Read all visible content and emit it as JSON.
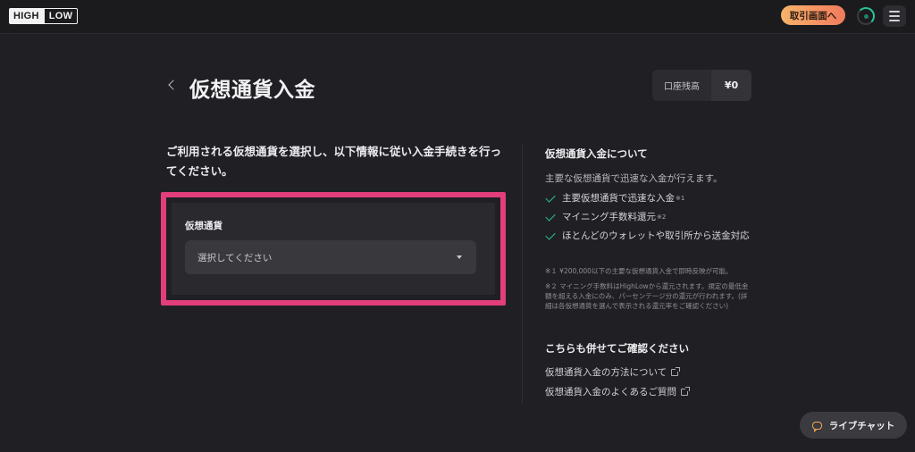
{
  "header": {
    "logo_high": "HIGH",
    "logo_low": "LOW",
    "trade_button_label": "取引画面へ",
    "accent_color": "#28c59a"
  },
  "page": {
    "title": "仮想通貨入金",
    "balance_label": "口座残高",
    "balance_value": "¥0"
  },
  "form": {
    "intro_text": "ご利用される仮想通貨を選択し、以下情報に従い入金手続きを行ってください。",
    "currency_label": "仮想通貨",
    "currency_select_placeholder": "選択してください",
    "highlight_color": "#e33e7c"
  },
  "info": {
    "title": "仮想通貨入金について",
    "lead": "主要な仮想通貨で迅速な入金が行えます。",
    "features": [
      {
        "text": "主要仮想通貨で迅速な入金",
        "mark": "※1"
      },
      {
        "text": "マイニング手数料還元",
        "mark": "※2"
      },
      {
        "text": "ほとんどのウォレットや取引所から送金対応",
        "mark": ""
      }
    ],
    "note1": "※１ ¥200,000以下の主要な仮想通貨入金で即時反映が可能。",
    "note2": "※２ マイニング手数料はHighLowから還元されます。規定の最低金額を超える入金にのみ、パーセンテージ分の還元が行われます。(詳細は各仮想通貨を選んで表示される還元率をご確認ください)",
    "also_title": "こちらも併せてご確認ください",
    "link1": "仮想通貨入金の方法について",
    "link2": "仮想通貨入金のよくあるご質問"
  },
  "chat": {
    "label": "ライブチャット"
  }
}
